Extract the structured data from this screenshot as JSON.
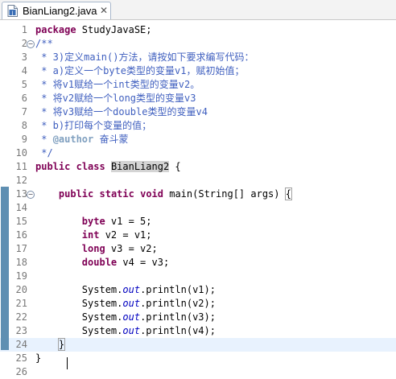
{
  "tab": {
    "title": "BianLiang2.java",
    "close": "✕",
    "icon": "java-file-icon"
  },
  "lines": [
    {
      "num": "1",
      "fold": "",
      "segments": [
        {
          "t": "package",
          "c": "kw"
        },
        {
          "t": " StudyJavaSE;",
          "c": ""
        }
      ]
    },
    {
      "num": "2",
      "fold": "−",
      "segments": [
        {
          "t": "/**",
          "c": "cm"
        }
      ]
    },
    {
      "num": "3",
      "fold": "",
      "segments": [
        {
          "t": " * 3)定义main()方法，请按如下要求编写代码：",
          "c": "cm"
        }
      ]
    },
    {
      "num": "4",
      "fold": "",
      "segments": [
        {
          "t": " * a)定义一个byte类型的变量v1，赋初始值；",
          "c": "cm"
        }
      ]
    },
    {
      "num": "5",
      "fold": "",
      "segments": [
        {
          "t": " * 将v1赋给一个int类型的变量v2。",
          "c": "cm"
        }
      ]
    },
    {
      "num": "6",
      "fold": "",
      "segments": [
        {
          "t": " * 将v2赋给一个long类型的变量v3",
          "c": "cm"
        }
      ]
    },
    {
      "num": "7",
      "fold": "",
      "segments": [
        {
          "t": " * 将v3赋给一个double类型的变量v4",
          "c": "cm"
        }
      ]
    },
    {
      "num": "8",
      "fold": "",
      "segments": [
        {
          "t": " * b)打印每个变量的值；",
          "c": "cm"
        }
      ]
    },
    {
      "num": "9",
      "fold": "",
      "segments": [
        {
          "t": " * ",
          "c": "cm"
        },
        {
          "t": "@author",
          "c": "cmtag"
        },
        {
          "t": " 奋斗蒙",
          "c": "cm"
        }
      ]
    },
    {
      "num": "10",
      "fold": "",
      "segments": [
        {
          "t": " */",
          "c": "cm"
        }
      ]
    },
    {
      "num": "11",
      "fold": "",
      "segments": [
        {
          "t": "public",
          "c": "kw"
        },
        {
          "t": " ",
          "c": ""
        },
        {
          "t": "class",
          "c": "kw"
        },
        {
          "t": " ",
          "c": ""
        },
        {
          "t": "BianLiang2",
          "c": "hl-cls"
        },
        {
          "t": " {",
          "c": ""
        }
      ]
    },
    {
      "num": "12",
      "fold": "",
      "segments": []
    },
    {
      "num": "13",
      "fold": "−",
      "segments": [
        {
          "t": "    ",
          "c": ""
        },
        {
          "t": "public",
          "c": "kw"
        },
        {
          "t": " ",
          "c": ""
        },
        {
          "t": "static",
          "c": "kw"
        },
        {
          "t": " ",
          "c": ""
        },
        {
          "t": "void",
          "c": "kw"
        },
        {
          "t": " main(String[] args) ",
          "c": ""
        },
        {
          "t": "{",
          "c": "bracket-box"
        }
      ]
    },
    {
      "num": "14",
      "fold": "",
      "segments": []
    },
    {
      "num": "15",
      "fold": "",
      "segments": [
        {
          "t": "        ",
          "c": ""
        },
        {
          "t": "byte",
          "c": "kw"
        },
        {
          "t": " v1 = 5;",
          "c": ""
        }
      ]
    },
    {
      "num": "16",
      "fold": "",
      "segments": [
        {
          "t": "        ",
          "c": ""
        },
        {
          "t": "int",
          "c": "kw"
        },
        {
          "t": " v2 = v1;",
          "c": ""
        }
      ]
    },
    {
      "num": "17",
      "fold": "",
      "segments": [
        {
          "t": "        ",
          "c": ""
        },
        {
          "t": "long",
          "c": "kw"
        },
        {
          "t": " v3 = v2;",
          "c": ""
        }
      ]
    },
    {
      "num": "18",
      "fold": "",
      "segments": [
        {
          "t": "        ",
          "c": ""
        },
        {
          "t": "double",
          "c": "kw"
        },
        {
          "t": " v4 = v3;",
          "c": ""
        }
      ]
    },
    {
      "num": "19",
      "fold": "",
      "segments": []
    },
    {
      "num": "20",
      "fold": "",
      "segments": [
        {
          "t": "        System.",
          "c": ""
        },
        {
          "t": "out",
          "c": "static"
        },
        {
          "t": ".println(v1);",
          "c": ""
        }
      ]
    },
    {
      "num": "21",
      "fold": "",
      "segments": [
        {
          "t": "        System.",
          "c": ""
        },
        {
          "t": "out",
          "c": "static"
        },
        {
          "t": ".println(v2);",
          "c": ""
        }
      ]
    },
    {
      "num": "22",
      "fold": "",
      "segments": [
        {
          "t": "        System.",
          "c": ""
        },
        {
          "t": "out",
          "c": "static"
        },
        {
          "t": ".println(v3);",
          "c": ""
        }
      ]
    },
    {
      "num": "23",
      "fold": "",
      "segments": [
        {
          "t": "        System.",
          "c": ""
        },
        {
          "t": "out",
          "c": "static"
        },
        {
          "t": ".println(v4);",
          "c": ""
        }
      ]
    },
    {
      "num": "24",
      "fold": "",
      "current": true,
      "segments": [
        {
          "t": "    ",
          "c": ""
        },
        {
          "t": "}",
          "c": "bracket-box"
        }
      ]
    },
    {
      "num": "25",
      "fold": "",
      "segments": [
        {
          "t": "}",
          "c": ""
        }
      ]
    },
    {
      "num": "26",
      "fold": "",
      "segments": []
    }
  ],
  "colors": {
    "keyword": "#7f0055",
    "comment": "#3f5fbf",
    "javadoc_tag": "#7f9fbf",
    "static_field": "#0000c0",
    "current_line": "#e8f2fe",
    "change_bar": "#5f8fb2"
  }
}
